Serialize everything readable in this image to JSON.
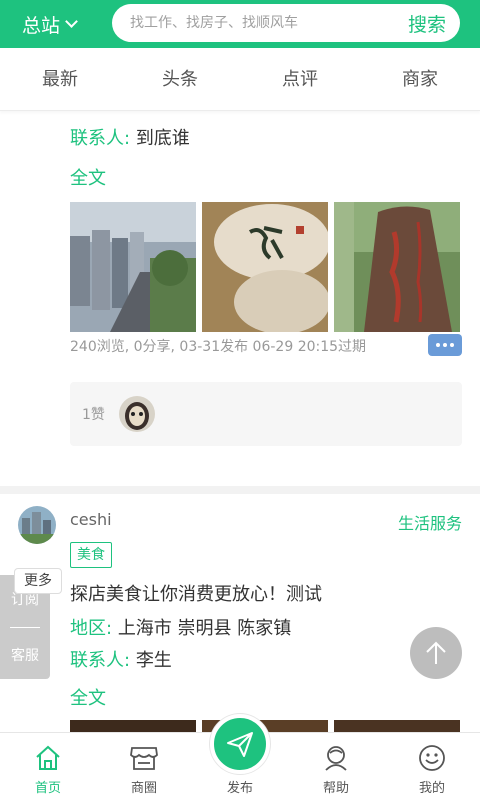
{
  "header": {
    "station_label": "总站",
    "search_placeholder": "找工作、找房子、找顺风车",
    "search_button": "搜索"
  },
  "tabs": [
    {
      "label": "最新"
    },
    {
      "label": "头条"
    },
    {
      "label": "点评"
    },
    {
      "label": "商家"
    }
  ],
  "post1": {
    "contact_label": "联系人:",
    "contact_value": "到底谁",
    "fulltext": "全文",
    "meta": "240浏览, 0分享, 03-31发布 06-29 20:15过期",
    "likes": "1赞"
  },
  "post2": {
    "username": "ceshi",
    "category": "生活服务",
    "tag": "美食",
    "title": "探店美食让你消费更放心！测试",
    "region_label": "地区:",
    "region_value": "上海市 崇明县 陈家镇",
    "contact_label": "联系人:",
    "contact_value": "李生",
    "fulltext": "全文"
  },
  "side": {
    "more": "更多",
    "subscribe": "订阅",
    "service": "客服"
  },
  "bottom_nav": [
    {
      "label": "首页",
      "icon": "home-icon",
      "active": true
    },
    {
      "label": "商圈",
      "icon": "store-icon",
      "active": false
    },
    {
      "label": "发布",
      "icon": "paper-plane-icon",
      "active": false
    },
    {
      "label": "帮助",
      "icon": "help-icon",
      "active": false
    },
    {
      "label": "我的",
      "icon": "smiley-icon",
      "active": false
    }
  ],
  "colors": {
    "accent": "#1ec27f",
    "more_button": "#6a9bd8"
  }
}
